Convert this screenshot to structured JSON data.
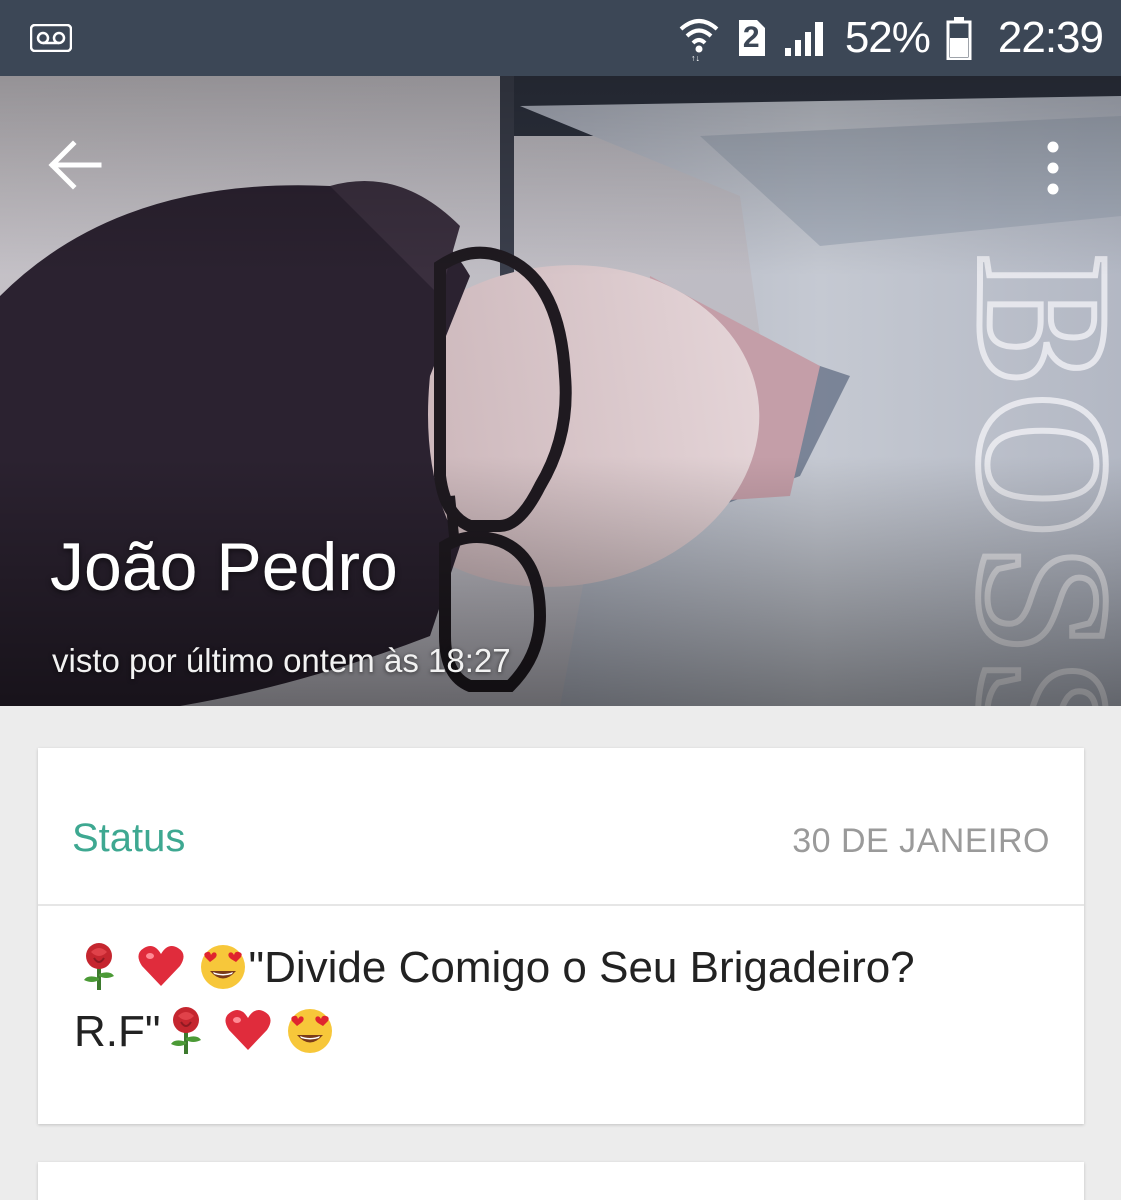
{
  "status_bar": {
    "left_icon": "voicemail-icon",
    "icons": [
      "wifi-icon",
      "sim-2-icon",
      "signal-icon",
      "battery-icon"
    ],
    "sim_label": "2",
    "battery": "52%",
    "time": "22:39"
  },
  "header": {
    "back_icon": "arrow-left-icon",
    "menu_icon": "more-vert-icon",
    "name": "João Pedro",
    "last_seen": "visto por último ontem às 18:27",
    "photo_shirt_text": "BOSS"
  },
  "status_card": {
    "title": "Status",
    "date": "30 DE JANEIRO",
    "text_part1": "\"Divide Comigo o Seu Brigadeiro?",
    "text_part2": "R.F\"",
    "emojis": [
      "rose-icon",
      "heart-icon",
      "heart-eyes-icon"
    ]
  },
  "colors": {
    "status_bar": "#3c4756",
    "accent": "#3ea891",
    "date_gray": "#9a9a9a",
    "background": "#ececec"
  }
}
